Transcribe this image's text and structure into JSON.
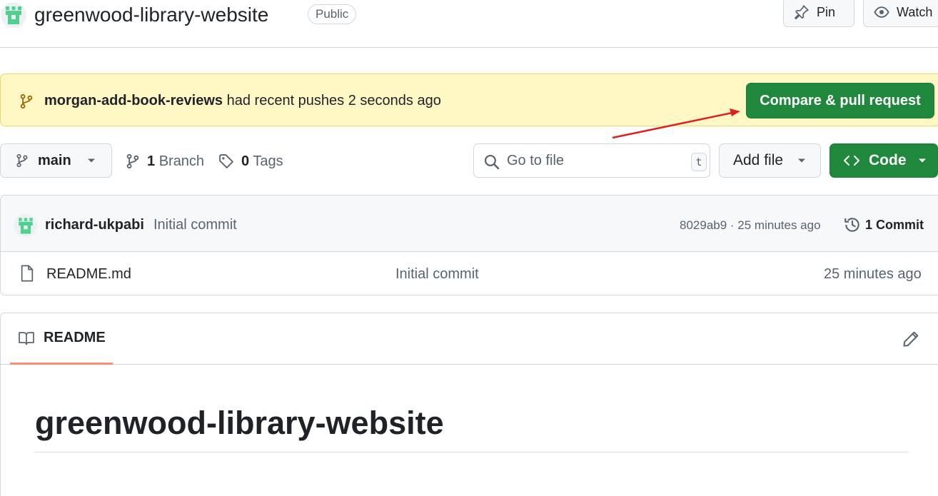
{
  "repo": {
    "name": "greenwood-library-website",
    "visibility": "Public",
    "actions": {
      "pin_label": "Pin",
      "watch_label": "Watch"
    }
  },
  "push_banner": {
    "branch": "morgan-add-book-reviews",
    "message": "had recent pushes 2 seconds ago",
    "compare_label": "Compare & pull request"
  },
  "toolbar": {
    "current_branch": "main",
    "branches_count": "1",
    "branches_label": "Branch",
    "tags_count": "0",
    "tags_label": "Tags",
    "file_search_placeholder": "Go to file",
    "file_search_shortcut": "t",
    "add_file_label": "Add file",
    "code_label": "Code"
  },
  "latest_commit": {
    "author": "richard-ukpabi",
    "message": "Initial commit",
    "meta": "8029ab9 · 25 minutes ago",
    "count_label": "1 Commit"
  },
  "files": [
    {
      "name": "README.md",
      "commit_message": "Initial commit",
      "age": "25 minutes ago"
    }
  ],
  "readme": {
    "tab_label": "README",
    "heading": "greenwood-library-website"
  },
  "colors": {
    "primary_button": "#1f883d",
    "banner_background": "#fff8c5",
    "tab_underline": "#fd8c73",
    "annotation_arrow": "#e02020",
    "avatar_green": "#4fd08f"
  },
  "icons": [
    "repo-owner-avatar",
    "pin-icon",
    "eye-icon",
    "git-branch-icon",
    "tag-icon",
    "search-icon",
    "caret-down-icon",
    "code-icon",
    "history-icon",
    "file-icon",
    "book-icon",
    "pencil-icon"
  ]
}
